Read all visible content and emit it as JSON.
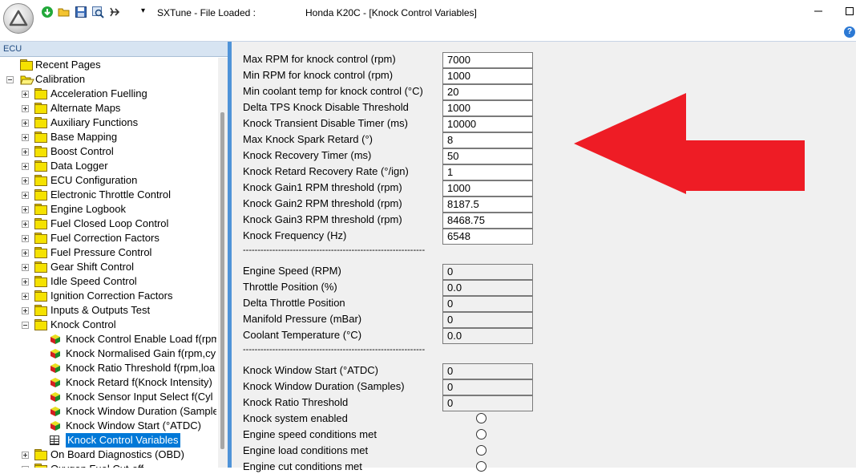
{
  "window": {
    "app_title": "SXTune - File Loaded :",
    "doc_title": "Honda K20C - [Knock Control Variables]",
    "help_label": "?"
  },
  "left_panel": {
    "header": "ECU",
    "tree": [
      {
        "label": "Recent Pages",
        "level": 0,
        "kind": "folder",
        "expander": "none"
      },
      {
        "label": "Calibration",
        "level": 0,
        "kind": "folder-open",
        "expander": "minus"
      },
      {
        "label": "Acceleration Fuelling",
        "level": 1,
        "kind": "folder",
        "expander": "plus"
      },
      {
        "label": "Alternate Maps",
        "level": 1,
        "kind": "folder",
        "expander": "plus"
      },
      {
        "label": "Auxiliary Functions",
        "level": 1,
        "kind": "folder",
        "expander": "plus"
      },
      {
        "label": "Base Mapping",
        "level": 1,
        "kind": "folder",
        "expander": "plus"
      },
      {
        "label": "Boost Control",
        "level": 1,
        "kind": "folder",
        "expander": "plus"
      },
      {
        "label": "Data Logger",
        "level": 1,
        "kind": "folder",
        "expander": "plus"
      },
      {
        "label": "ECU Configuration",
        "level": 1,
        "kind": "folder",
        "expander": "plus"
      },
      {
        "label": "Electronic Throttle Control",
        "level": 1,
        "kind": "folder",
        "expander": "plus"
      },
      {
        "label": "Engine Logbook",
        "level": 1,
        "kind": "folder",
        "expander": "plus"
      },
      {
        "label": "Fuel Closed Loop Control",
        "level": 1,
        "kind": "folder",
        "expander": "plus"
      },
      {
        "label": "Fuel Correction Factors",
        "level": 1,
        "kind": "folder",
        "expander": "plus"
      },
      {
        "label": "Fuel Pressure Control",
        "level": 1,
        "kind": "folder",
        "expander": "plus"
      },
      {
        "label": "Gear Shift Control",
        "level": 1,
        "kind": "folder",
        "expander": "plus"
      },
      {
        "label": "Idle Speed Control",
        "level": 1,
        "kind": "folder",
        "expander": "plus"
      },
      {
        "label": "Ignition Correction Factors",
        "level": 1,
        "kind": "folder",
        "expander": "plus"
      },
      {
        "label": "Inputs & Outputs Test",
        "level": 1,
        "kind": "folder",
        "expander": "plus"
      },
      {
        "label": "Knock Control",
        "level": 1,
        "kind": "folder",
        "expander": "minus"
      },
      {
        "label": "Knock Control Enable Load f(rpm",
        "level": 2,
        "kind": "cube"
      },
      {
        "label": "Knock Normalised Gain f(rpm,cy",
        "level": 2,
        "kind": "cube"
      },
      {
        "label": "Knock Ratio Threshold f(rpm,loa",
        "level": 2,
        "kind": "cube"
      },
      {
        "label": "Knock Retard f(Knock Intensity)",
        "level": 2,
        "kind": "cube"
      },
      {
        "label": "Knock Sensor Input Select f(Cyl",
        "level": 2,
        "kind": "cube"
      },
      {
        "label": "Knock Window Duration (Sample",
        "level": 2,
        "kind": "cube"
      },
      {
        "label": "Knock Window Start (°ATDC)",
        "level": 2,
        "kind": "cube"
      },
      {
        "label": "Knock Control Variables",
        "level": 2,
        "kind": "grid",
        "selected": true
      },
      {
        "label": "On Board Diagnostics (OBD)",
        "level": 1,
        "kind": "folder",
        "expander": "plus"
      },
      {
        "label": "Oxygen Fuel Cut-off...",
        "level": 1,
        "kind": "folder",
        "expander": "plus"
      }
    ]
  },
  "content": {
    "settings": [
      {
        "label": "Max RPM for knock control (rpm)",
        "value": "7000"
      },
      {
        "label": "Min RPM for knock control (rpm)",
        "value": "1000"
      },
      {
        "label": "Min coolant temp for knock control (°C)",
        "value": "20"
      },
      {
        "label": "Delta TPS Knock Disable Threshold",
        "value": "1000"
      },
      {
        "label": "Knock Transient Disable Timer (ms)",
        "value": "10000"
      },
      {
        "label": "Max Knock Spark Retard (°)",
        "value": "8"
      },
      {
        "label": "Knock Recovery Timer (ms)",
        "value": "50"
      },
      {
        "label": "Knock Retard Recovery Rate (°/ign)",
        "value": "1"
      },
      {
        "label": "Knock Gain1 RPM threshold (rpm)",
        "value": "1000"
      },
      {
        "label": "Knock Gain2 RPM threshold (rpm)",
        "value": "8187.5"
      },
      {
        "label": "Knock Gain3 RPM threshold (rpm)",
        "value": "8468.75"
      },
      {
        "label": "Knock Frequency (Hz)",
        "value": "6548"
      }
    ],
    "separator": "--------------------------------------------------------------",
    "live_values": [
      {
        "label": "Engine Speed (RPM)",
        "value": "0"
      },
      {
        "label": "Throttle Position (%)",
        "value": "0.0"
      },
      {
        "label": "Delta Throttle Position",
        "value": "0"
      },
      {
        "label": "Manifold Pressure (mBar)",
        "value": "0"
      },
      {
        "label": "Coolant Temperature (°C)",
        "value": "0.0"
      }
    ],
    "window_values": [
      {
        "label": "Knock Window Start (°ATDC)",
        "value": "0"
      },
      {
        "label": "Knock Window Duration (Samples)",
        "value": "0"
      },
      {
        "label": "Knock Ratio Threshold",
        "value": "0"
      }
    ],
    "conditions": [
      {
        "label": "Knock system enabled",
        "checked": false
      },
      {
        "label": "Engine speed conditions met",
        "checked": false
      },
      {
        "label": "Engine load conditions met",
        "checked": false
      },
      {
        "label": "Engine cut conditions met",
        "checked": false
      }
    ]
  },
  "colors": {
    "divider": "#4f93d8",
    "selection": "#0078d7",
    "arrow": "#ee1c25",
    "content_bg": "#f0f0f0"
  }
}
